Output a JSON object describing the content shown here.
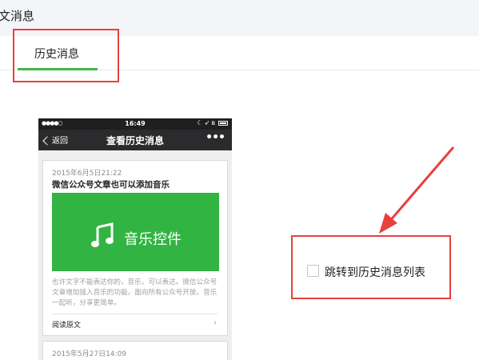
{
  "header": {
    "title": "文消息"
  },
  "tabs": [
    {
      "label": "历史消息",
      "active": true
    }
  ],
  "accent_color": "#44b549",
  "highlight_color": "#e8403c",
  "phone": {
    "status_bar": {
      "signal": "●●●●○",
      "time": "16:49"
    },
    "nav": {
      "back_label": "返回",
      "title": "查看历史消息",
      "more": "•••"
    },
    "articles": [
      {
        "date": "2015年6月5日21:22",
        "title": "微信公众号文章也可以添加音乐",
        "cover_text": "音乐控件",
        "description": "也许文字不能表达你的，音乐，可以表达。微信公众号文章增加插入音乐的功能，面向所有公众号开放。音乐一起听，分享更简单。",
        "read_more": "阅读原文"
      },
      {
        "date": "2015年5月27日14:09"
      }
    ]
  },
  "option": {
    "label": "跳转到历史消息列表",
    "checked": false
  }
}
